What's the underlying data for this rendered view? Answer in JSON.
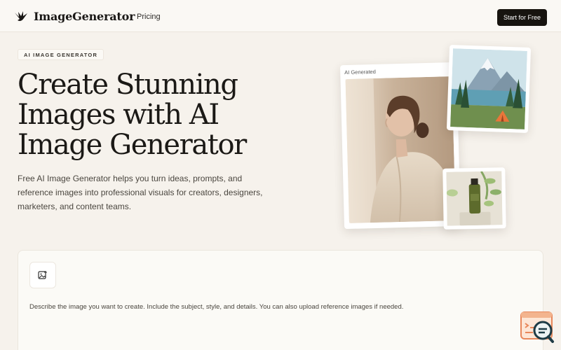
{
  "header": {
    "brand": "ImageGenerator",
    "nav_pricing": "Pricing",
    "cta": "Start for Free"
  },
  "hero": {
    "badge": "AI IMAGE GENERATOR",
    "title_lines": [
      "Create Stunning",
      "Images with AI",
      "Image Generator"
    ],
    "subtitle": "Free AI Image Generator helps you turn ideas, prompts, and reference images into professional visuals for creators, designers, marketers, and content teams."
  },
  "gallery": {
    "main_caption": "AI Generated"
  },
  "prompt": {
    "placeholder": "Describe the image you want to create. Include the subject, style, and details. You can also upload reference images if needed."
  },
  "icons": {
    "logo": "bird-logo-icon",
    "upload": "image-upload-icon",
    "helper": "chat-helper-icon"
  },
  "colors": {
    "background": "#f6f2ec",
    "cta": "#17140f",
    "helper_accent": "#e8875a"
  }
}
